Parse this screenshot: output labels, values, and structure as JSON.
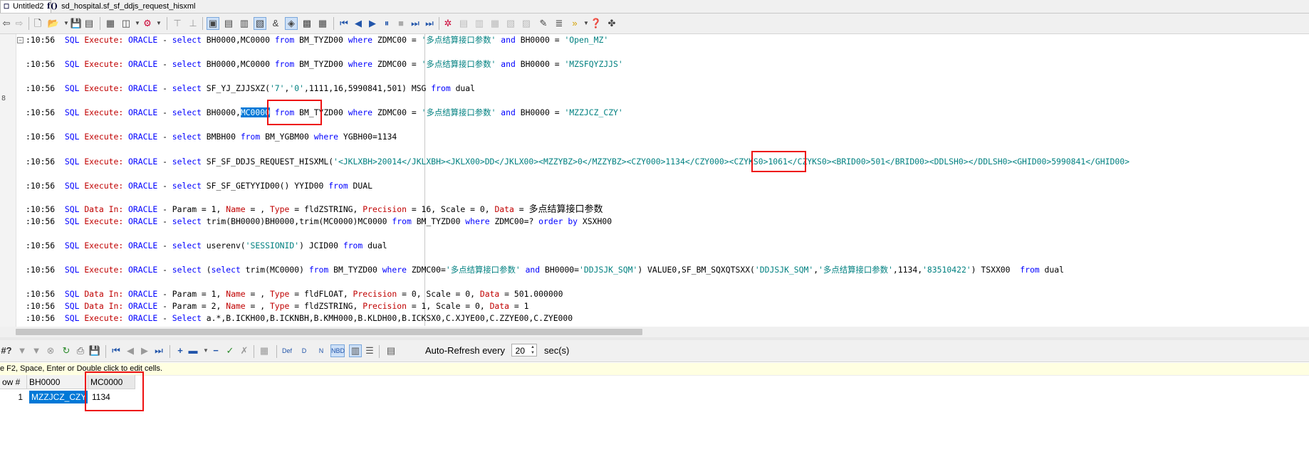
{
  "colors": {
    "keyword": "#0000ff",
    "sql_kind": "#c00000",
    "string": "#008080",
    "selection": "#0078d7",
    "highlight_box": "#ee1111"
  },
  "tabs": [
    {
      "label": "Untitled2",
      "icon": "sql-window-icon"
    },
    {
      "label": "sd_hospital.sf_sf_ddjs_request_hisxml",
      "icon": "function-icon"
    }
  ],
  "editor": {
    "gutter_number": "8",
    "lines": [
      [
        [
          ":10:56  ",
          ""
        ],
        [
          "SQL ",
          "kw"
        ],
        [
          "Execute: ",
          "sk"
        ],
        [
          "ORACLE ",
          "kw"
        ],
        [
          "- ",
          ""
        ],
        [
          "select ",
          "kw"
        ],
        [
          "BH0000,MC0000 ",
          ""
        ],
        [
          "from ",
          "kw"
        ],
        [
          "BM_TYZD00 ",
          ""
        ],
        [
          "where ",
          "kw"
        ],
        [
          "ZDMC00 = ",
          ""
        ],
        [
          "'多点结算接口参数'",
          "str"
        ],
        [
          " and ",
          "kw"
        ],
        [
          "BH0000 = ",
          ""
        ],
        [
          "'Open_MZ'",
          "str"
        ]
      ],
      [
        [
          ":10:56  ",
          ""
        ],
        [
          "SQL ",
          "kw"
        ],
        [
          "Execute: ",
          "sk"
        ],
        [
          "ORACLE ",
          "kw"
        ],
        [
          "- ",
          ""
        ],
        [
          "select ",
          "kw"
        ],
        [
          "BH0000,MC0000 ",
          ""
        ],
        [
          "from ",
          "kw"
        ],
        [
          "BM_TYZD00 ",
          ""
        ],
        [
          "where ",
          "kw"
        ],
        [
          "ZDMC00 = ",
          ""
        ],
        [
          "'多点结算接口参数'",
          "str"
        ],
        [
          " and ",
          "kw"
        ],
        [
          "BH0000 = ",
          ""
        ],
        [
          "'MZSFQYZJJS'",
          "str"
        ]
      ],
      [
        [
          ":10:56  ",
          ""
        ],
        [
          "SQL ",
          "kw"
        ],
        [
          "Execute: ",
          "sk"
        ],
        [
          "ORACLE ",
          "kw"
        ],
        [
          "- ",
          ""
        ],
        [
          "select ",
          "kw"
        ],
        [
          "SF_YJ_ZJJSXZ(",
          ""
        ],
        [
          "'7'",
          "str"
        ],
        [
          ",",
          ""
        ],
        [
          "'0'",
          "str"
        ],
        [
          ",1111,16,5990841,501) MSG ",
          ""
        ],
        [
          "from ",
          "kw"
        ],
        [
          "dual",
          ""
        ]
      ],
      [
        [
          ":10:56  ",
          ""
        ],
        [
          "SQL ",
          "kw"
        ],
        [
          "Execute: ",
          "sk"
        ],
        [
          "ORACLE ",
          "kw"
        ],
        [
          "- ",
          ""
        ],
        [
          "select ",
          "kw"
        ],
        [
          "BH0000,",
          ""
        ],
        [
          "MC0000",
          "sel"
        ],
        [
          " ",
          ""
        ],
        [
          "from ",
          "kw"
        ],
        [
          "BM_TYZD00 ",
          ""
        ],
        [
          "where ",
          "kw"
        ],
        [
          "ZDMC00 = ",
          ""
        ],
        [
          "'多点结算接口参数'",
          "str"
        ],
        [
          " and ",
          "kw"
        ],
        [
          "BH0000 = ",
          ""
        ],
        [
          "'MZZJCZ_CZY'",
          "str"
        ]
      ],
      [
        [
          ":10:56  ",
          ""
        ],
        [
          "SQL ",
          "kw"
        ],
        [
          "Execute: ",
          "sk"
        ],
        [
          "ORACLE ",
          "kw"
        ],
        [
          "- ",
          ""
        ],
        [
          "select ",
          "kw"
        ],
        [
          "BMBH00 ",
          ""
        ],
        [
          "from ",
          "kw"
        ],
        [
          "BM_YGBM00 ",
          ""
        ],
        [
          "where ",
          "kw"
        ],
        [
          "YGBH00=1134",
          ""
        ]
      ],
      [
        [
          ":10:56  ",
          ""
        ],
        [
          "SQL ",
          "kw"
        ],
        [
          "Execute: ",
          "sk"
        ],
        [
          "ORACLE ",
          "kw"
        ],
        [
          "- ",
          ""
        ],
        [
          "select ",
          "kw"
        ],
        [
          "SF_SF_DDJS_REQUEST_HISXML(",
          ""
        ],
        [
          "'<JKLXBH>20014</JKLXBH><JKLX00>DD</JKLX00><MZZYBZ>0</MZZYBZ><CZY000>1134</CZY000><CZYKS0>1061</CZYKS0><BRID00>501</BRID00><DDLSH0></DDLSH0><GHID00>5990841</GHID00>",
          "str"
        ]
      ],
      [
        [
          ":10:56  ",
          ""
        ],
        [
          "SQL ",
          "kw"
        ],
        [
          "Execute: ",
          "sk"
        ],
        [
          "ORACLE ",
          "kw"
        ],
        [
          "- ",
          ""
        ],
        [
          "select ",
          "kw"
        ],
        [
          "SF_SF_GETYYID00() YYID00 ",
          ""
        ],
        [
          "from ",
          "kw"
        ],
        [
          "DUAL",
          ""
        ]
      ],
      [
        [
          ":10:56  ",
          ""
        ],
        [
          "SQL ",
          "kw"
        ],
        [
          "Data In: ",
          "sk"
        ],
        [
          "ORACLE ",
          "kw"
        ],
        [
          "- Param = 1, ",
          ""
        ],
        [
          "Name ",
          "sk"
        ],
        [
          "= , ",
          ""
        ],
        [
          "Type ",
          "sk"
        ],
        [
          "= fldZSTRING, ",
          ""
        ],
        [
          "Precision ",
          "sk"
        ],
        [
          "= 16, Scale = 0, ",
          ""
        ],
        [
          "Data ",
          "sk"
        ],
        [
          "= ",
          ""
        ],
        [
          "多点结算接口参数",
          "cn"
        ]
      ],
      [
        [
          ":10:56  ",
          ""
        ],
        [
          "SQL ",
          "kw"
        ],
        [
          "Execute: ",
          "sk"
        ],
        [
          "ORACLE ",
          "kw"
        ],
        [
          "- ",
          ""
        ],
        [
          "select ",
          "kw"
        ],
        [
          "trim(BH0000)BH0000,trim(MC0000)MC0000 ",
          ""
        ],
        [
          "from ",
          "kw"
        ],
        [
          "BM_TYZD00 ",
          ""
        ],
        [
          "where ",
          "kw"
        ],
        [
          "ZDMC00=? ",
          ""
        ],
        [
          "order by ",
          "kw"
        ],
        [
          "XSXH00",
          ""
        ]
      ],
      [
        [
          ":10:56  ",
          ""
        ],
        [
          "SQL ",
          "kw"
        ],
        [
          "Execute: ",
          "sk"
        ],
        [
          "ORACLE ",
          "kw"
        ],
        [
          "- ",
          ""
        ],
        [
          "select ",
          "kw"
        ],
        [
          "userenv(",
          ""
        ],
        [
          "'SESSIONID'",
          "str"
        ],
        [
          ") JCID00 ",
          ""
        ],
        [
          "from ",
          "kw"
        ],
        [
          "dual",
          ""
        ]
      ],
      [
        [
          ":10:56  ",
          ""
        ],
        [
          "SQL ",
          "kw"
        ],
        [
          "Execute: ",
          "sk"
        ],
        [
          "ORACLE ",
          "kw"
        ],
        [
          "- ",
          ""
        ],
        [
          "select ",
          "kw"
        ],
        [
          "(",
          ""
        ],
        [
          "select ",
          "kw"
        ],
        [
          "trim(MC0000) ",
          ""
        ],
        [
          "from ",
          "kw"
        ],
        [
          "BM_TYZD00 ",
          ""
        ],
        [
          "where ",
          "kw"
        ],
        [
          "ZDMC00=",
          ""
        ],
        [
          "'多点结算接口参数'",
          "str"
        ],
        [
          " and ",
          "kw"
        ],
        [
          "BH0000=",
          ""
        ],
        [
          "'DDJSJK_SQM'",
          "str"
        ],
        [
          ") VALUE0,SF_BM_SQXQTSXX(",
          ""
        ],
        [
          "'DDJSJK_SQM'",
          "str"
        ],
        [
          ",",
          ""
        ],
        [
          "'多点结算接口参数'",
          "str"
        ],
        [
          ",1134,",
          ""
        ],
        [
          "'83510422'",
          "str"
        ],
        [
          ") TSXX00  ",
          ""
        ],
        [
          "from ",
          "kw"
        ],
        [
          "dual",
          ""
        ]
      ],
      [
        [
          ":10:56  ",
          ""
        ],
        [
          "SQL ",
          "kw"
        ],
        [
          "Data In: ",
          "sk"
        ],
        [
          "ORACLE ",
          "kw"
        ],
        [
          "- Param = 1, ",
          ""
        ],
        [
          "Name ",
          "sk"
        ],
        [
          "= , ",
          ""
        ],
        [
          "Type ",
          "sk"
        ],
        [
          "= fldFLOAT, ",
          ""
        ],
        [
          "Precision ",
          "sk"
        ],
        [
          "= 0, Scale = 0, ",
          ""
        ],
        [
          "Data ",
          "sk"
        ],
        [
          "= 501.000000",
          ""
        ]
      ],
      [
        [
          ":10:56  ",
          ""
        ],
        [
          "SQL ",
          "kw"
        ],
        [
          "Data In: ",
          "sk"
        ],
        [
          "ORACLE ",
          "kw"
        ],
        [
          "- Param = 2, ",
          ""
        ],
        [
          "Name ",
          "sk"
        ],
        [
          "= , ",
          ""
        ],
        [
          "Type ",
          "sk"
        ],
        [
          "= fldZSTRING, ",
          ""
        ],
        [
          "Precision ",
          "sk"
        ],
        [
          "= 1, Scale = 0, ",
          ""
        ],
        [
          "Data ",
          "sk"
        ],
        [
          "= 1",
          ""
        ]
      ],
      [
        [
          ":10:56  ",
          ""
        ],
        [
          "SQL ",
          "kw"
        ],
        [
          "Execute: ",
          "sk"
        ],
        [
          "ORACLE ",
          "kw"
        ],
        [
          "- ",
          ""
        ],
        [
          "Select ",
          "kw"
        ],
        [
          "a.*,B.ICKH00,B.ICKNBH,B.KMH000,B.KLDH00,B.ICKSX0,C.XJYE00,C.ZZYE00,C.ZYE000",
          ""
        ]
      ]
    ]
  },
  "results": {
    "auto_refresh_label": "Auto-Refresh every",
    "auto_refresh_value": "20",
    "auto_refresh_unit": "sec(s)",
    "hint": "e F2, Space, Enter or Double click to edit cells.",
    "columns": [
      "ow  #",
      "BH0000",
      "MC0000"
    ],
    "rows": [
      {
        "num": "1",
        "BH0000": "MZZJCZ_CZY",
        "MC0000": "1134"
      }
    ]
  }
}
